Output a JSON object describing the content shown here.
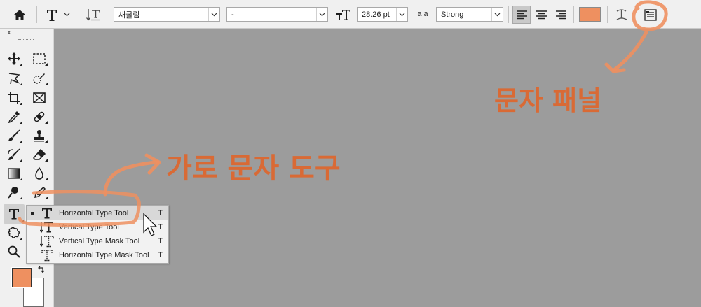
{
  "options_bar": {
    "font_family": "새굴림",
    "font_style": "-",
    "font_size": "28.26 pt",
    "anti_alias_icon_label": "a a",
    "anti_alias": "Strong",
    "text_color": "#ee9060"
  },
  "flyout": {
    "items": [
      {
        "label": "Horizontal Type Tool",
        "shortcut": "T"
      },
      {
        "label": "Vertical Type Tool",
        "shortcut": "T"
      },
      {
        "label": "Vertical Type Mask Tool",
        "shortcut": "T"
      },
      {
        "label": "Horizontal Type Mask Tool",
        "shortcut": "T"
      }
    ]
  },
  "annotations": {
    "character_panel": "문자 패널",
    "horizontal_type_tool": "가로 문자 도구",
    "color": "#d96a35"
  },
  "colors": {
    "foreground": "#ee9060",
    "background": "#ffffff",
    "canvas": "#9c9c9c"
  }
}
